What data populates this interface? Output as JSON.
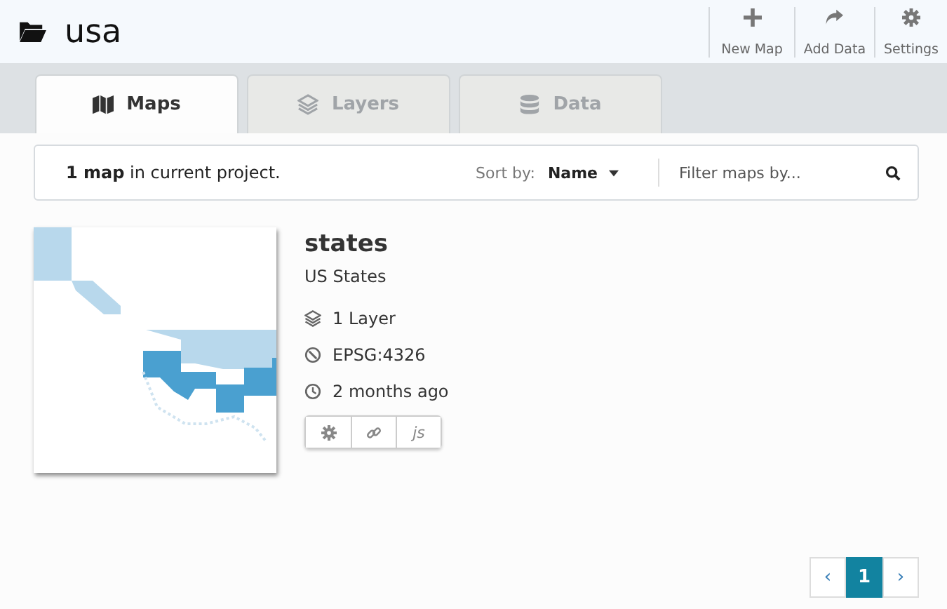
{
  "project": {
    "title": "usa"
  },
  "header_actions": [
    {
      "kind": "new",
      "label": "New Map"
    },
    {
      "kind": "add",
      "label": "Add Data"
    },
    {
      "kind": "settings",
      "label": "Settings"
    }
  ],
  "tabs": [
    {
      "kind": "maps",
      "label": "Maps",
      "selected": true
    },
    {
      "kind": "layers",
      "label": "Layers",
      "selected": false
    },
    {
      "kind": "data",
      "label": "Data",
      "selected": false
    }
  ],
  "toolbar": {
    "summary": "**1 map** in current project.",
    "sort_label": "Sort by:",
    "sort_value": "Name",
    "filter": {
      "placeholder": "Filter maps by..."
    }
  },
  "maps": [
    {
      "name": "states",
      "description": "US States",
      "layers": "1 Layer",
      "projection": "EPSG:4326",
      "updated": "2 months ago",
      "js_label": "js"
    }
  ],
  "pagination": {
    "prev": "‹",
    "next": "›",
    "pages": [
      {
        "label": "1",
        "selected": true
      }
    ]
  }
}
